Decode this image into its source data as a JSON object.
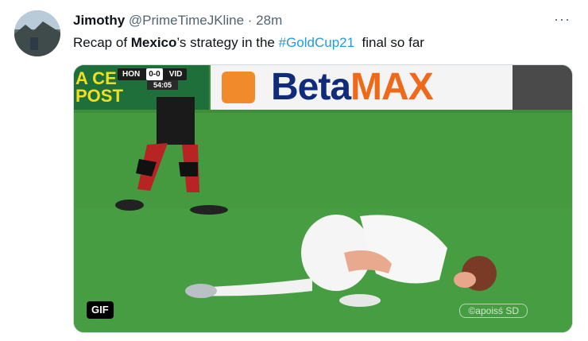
{
  "tweet": {
    "author_name": "Jimothy",
    "handle": "@PrimeTimeJKline",
    "separator": "·",
    "time": "28m",
    "more_label": "···",
    "text_prefix": "Recap of ",
    "text_bold": "Mexico",
    "text_mid": "’s strategy in the ",
    "hashtag": "#GoldCup21",
    "text_suffix": "  final so far"
  },
  "media": {
    "gif_badge": "GIF",
    "scorebug_home": "HON",
    "scorebug_score": "0-0",
    "scorebug_away": "VID",
    "clock": "54:05",
    "board_left": "A CE\nPOST",
    "board_brand_1": "Beta",
    "board_brand_2": "MAX",
    "watermark": "©apoisś SD"
  }
}
